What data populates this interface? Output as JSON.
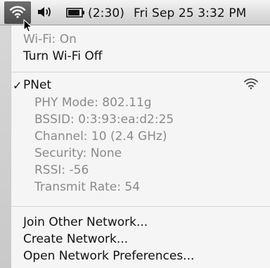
{
  "menubar": {
    "wifi_icon": "wifi-icon",
    "volume_icon": "volume-icon",
    "battery_icon": "battery-icon",
    "battery_time": "(2:30)",
    "datetime": "Fri Sep 25  3:32 PM"
  },
  "wifi_menu": {
    "status": "Wi-Fi: On",
    "toggle_label": "Turn Wi-Fi Off",
    "network": {
      "checkmark": "✓",
      "name": "PNet",
      "signal_icon": "wifi-signal-icon",
      "details": [
        "PHY Mode: 802.11g",
        "BSSID: 0:3:93:ea:d2:25",
        "Channel: 10 (2.4 GHz)",
        "Security: None",
        "RSSI: -56",
        "Transmit Rate: 54"
      ]
    },
    "actions": [
      "Join Other Network...",
      "Create Network...",
      "Open Network Preferences..."
    ]
  }
}
